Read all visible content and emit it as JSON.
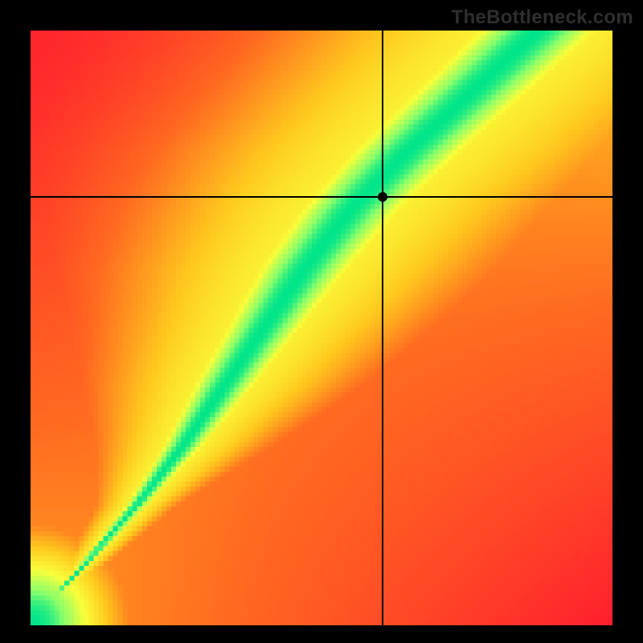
{
  "watermark": "TheBottleneck.com",
  "chart_data": {
    "type": "heatmap",
    "title": "",
    "xlabel": "",
    "ylabel": "",
    "xlim": [
      0,
      1
    ],
    "ylim": [
      0,
      1
    ],
    "crosshair": {
      "x": 0.605,
      "y": 0.72
    },
    "marker": {
      "x": 0.605,
      "y": 0.72
    },
    "colorscale": [
      {
        "t": 0.0,
        "hex": "#ff1a2e"
      },
      {
        "t": 0.3,
        "hex": "#ff6a20"
      },
      {
        "t": 0.55,
        "hex": "#ffc81e"
      },
      {
        "t": 0.75,
        "hex": "#f9ff3a"
      },
      {
        "t": 0.9,
        "hex": "#8cff6a"
      },
      {
        "t": 1.0,
        "hex": "#00e58a"
      }
    ],
    "ridge": {
      "description": "Optimal-balance curve (green ridge), monotone x as function of y",
      "points": [
        {
          "y": 0.0,
          "x": 0.0
        },
        {
          "y": 0.1,
          "x": 0.09
        },
        {
          "y": 0.2,
          "x": 0.18
        },
        {
          "y": 0.3,
          "x": 0.26
        },
        {
          "y": 0.4,
          "x": 0.33
        },
        {
          "y": 0.5,
          "x": 0.4
        },
        {
          "y": 0.6,
          "x": 0.47
        },
        {
          "y": 0.7,
          "x": 0.55
        },
        {
          "y": 0.8,
          "x": 0.65
        },
        {
          "y": 0.9,
          "x": 0.76
        },
        {
          "y": 1.0,
          "x": 0.87
        }
      ],
      "width_profile": [
        {
          "y": 0.0,
          "w": 0.002
        },
        {
          "y": 0.2,
          "w": 0.02
        },
        {
          "y": 0.4,
          "w": 0.06
        },
        {
          "y": 0.6,
          "w": 0.09
        },
        {
          "y": 0.8,
          "w": 0.11
        },
        {
          "y": 1.0,
          "w": 0.12
        }
      ]
    },
    "corner_intensity": {
      "top_left": 0.0,
      "top_right": 0.55,
      "bottom_left": 0.2,
      "bottom_right": 0.0
    },
    "grid": 120
  }
}
